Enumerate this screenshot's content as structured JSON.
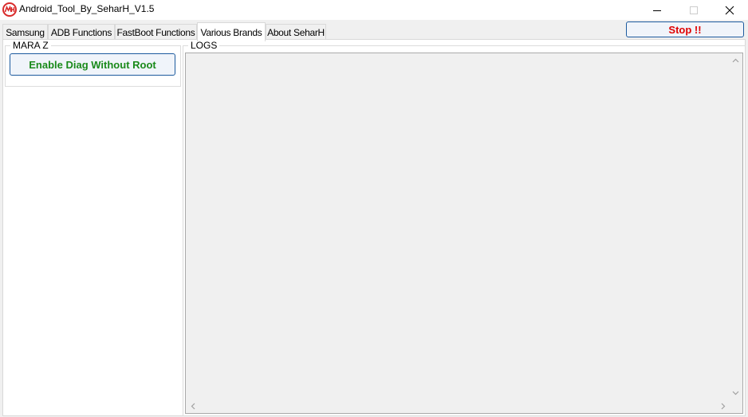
{
  "window": {
    "title": "Android_Tool_By_SeharH_V1.5",
    "app_icon": "mh-logo-icon",
    "controls": [
      "minimize-icon",
      "maximize-icon",
      "close-icon"
    ]
  },
  "tabs": [
    {
      "label": "Samsung",
      "active": false
    },
    {
      "label": "ADB Functions",
      "active": false
    },
    {
      "label": "FastBoot Functions",
      "active": false
    },
    {
      "label": "Various Brands",
      "active": true
    },
    {
      "label": "About SeharH",
      "active": false
    }
  ],
  "stop_button": {
    "label": "Stop !!",
    "color": "#e00000"
  },
  "mara_group": {
    "legend": "MARA Z",
    "button_label": "Enable Diag Without Root",
    "button_color": "#1a8a1a"
  },
  "logs_group": {
    "legend": "LOGS",
    "content": ""
  },
  "colors": {
    "button_border": "#1c5a9e",
    "log_background": "#f0f0f0",
    "icon_red": "#d92b2b"
  }
}
